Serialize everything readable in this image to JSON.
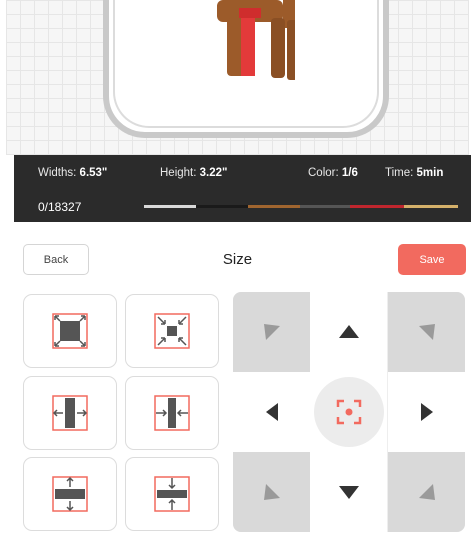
{
  "info": {
    "widths_label": "Widths:",
    "widths_value": "6.53\"",
    "height_label": "Height:",
    "height_value": "3.22\"",
    "color_label": "Color:",
    "color_value": "1/6",
    "time_label": "Time:",
    "time_value": "5min",
    "progress": "0/18327",
    "color_segments": [
      "#d9d9d9",
      "#1a1a1a",
      "#a0652f",
      "#555555",
      "#c0262e",
      "#d4b06a"
    ]
  },
  "panel": {
    "back_label": "Back",
    "title": "Size",
    "save_label": "Save"
  },
  "colors": {
    "accent": "#f26a5f",
    "tool_icon": "#555555",
    "dpad_grey": "#d9d9d9"
  },
  "tools": [
    "expand-to-hoop-icon",
    "shrink-icon",
    "widen-icon",
    "narrow-icon",
    "heighten-icon",
    "shorten-icon"
  ],
  "dpad": [
    "up-left",
    "up",
    "up-right",
    "left",
    "center-target",
    "right",
    "down-left",
    "down",
    "down-right"
  ]
}
